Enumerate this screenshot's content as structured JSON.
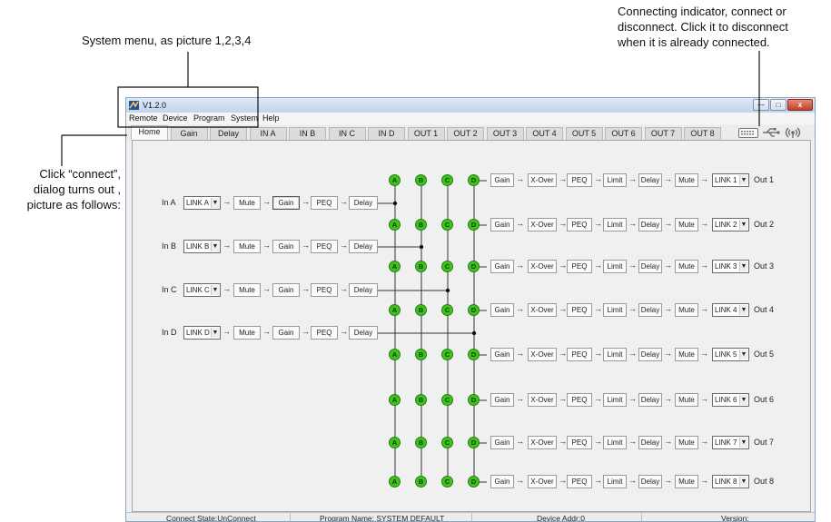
{
  "annotations": {
    "system_menu": "System menu, as picture 1,2,3,4",
    "connect_indicator": [
      "Connecting indicator, connect or",
      "disconnect. Click it to disconnect",
      "when it is already connected."
    ],
    "connect_dialog": [
      "Click “connect”,",
      "dialog turns out ,",
      "picture as follows:"
    ]
  },
  "window": {
    "title": "V1.2.0"
  },
  "menu": [
    "Remote",
    "Device",
    "Program",
    "System",
    "Help"
  ],
  "tabs": [
    "Home",
    "Gain",
    "Delay",
    "IN A",
    "IN B",
    "IN C",
    "IN D",
    "OUT 1",
    "OUT 2",
    "OUT 3",
    "OUT 4",
    "OUT 5",
    "OUT 6",
    "OUT 7",
    "OUT 8"
  ],
  "active_tab": "Home",
  "inputs": [
    {
      "name": "In A",
      "link": "LINK A",
      "chain": [
        "Mute",
        "Gain",
        "PEQ",
        "Delay"
      ]
    },
    {
      "name": "In B",
      "link": "LINK B",
      "chain": [
        "Mute",
        "Gain",
        "PEQ",
        "Delay"
      ]
    },
    {
      "name": "In C",
      "link": "LINK C",
      "chain": [
        "Mute",
        "Gain",
        "PEQ",
        "Delay"
      ]
    },
    {
      "name": "In D",
      "link": "LINK D",
      "chain": [
        "Mute",
        "Gain",
        "PEQ",
        "Delay"
      ]
    }
  ],
  "matrix_nodes": [
    "A",
    "B",
    "C",
    "D"
  ],
  "outputs": [
    {
      "name": "Out 1",
      "link": "LINK 1",
      "chain": [
        "Gain",
        "X-Over",
        "PEQ",
        "Limit",
        "Delay",
        "Mute"
      ]
    },
    {
      "name": "Out 2",
      "link": "LINK 2",
      "chain": [
        "Gain",
        "X-Over",
        "PEQ",
        "Limit",
        "Delay",
        "Mute"
      ]
    },
    {
      "name": "Out 3",
      "link": "LINK 3",
      "chain": [
        "Gain",
        "X-Over",
        "PEQ",
        "Limit",
        "Delay",
        "Mute"
      ]
    },
    {
      "name": "Out 4",
      "link": "LINK 4",
      "chain": [
        "Gain",
        "X-Over",
        "PEQ",
        "Limit",
        "Delay",
        "Mute"
      ]
    },
    {
      "name": "Out 5",
      "link": "LINK 5",
      "chain": [
        "Gain",
        "X-Over",
        "PEQ",
        "Limit",
        "Delay",
        "Mute"
      ]
    },
    {
      "name": "Out 6",
      "link": "LINK 6",
      "chain": [
        "Gain",
        "X-Over",
        "PEQ",
        "Limit",
        "Delay",
        "Mute"
      ]
    },
    {
      "name": "Out 7",
      "link": "LINK 7",
      "chain": [
        "Gain",
        "X-Over",
        "PEQ",
        "Limit",
        "Delay",
        "Mute"
      ]
    },
    {
      "name": "Out 8",
      "link": "LINK 8",
      "chain": [
        "Gain",
        "X-Over",
        "PEQ",
        "Limit",
        "Delay",
        "Mute"
      ]
    }
  ],
  "status": {
    "connect_state": "Connect State:UnConnect",
    "program_name": "Program Name: SYSTEM DEFAULT",
    "device_addr": "Device Addr:0",
    "version": "Version:"
  },
  "colors": {
    "node": "#3fc21e",
    "titlebar": "#c3d4ec"
  }
}
